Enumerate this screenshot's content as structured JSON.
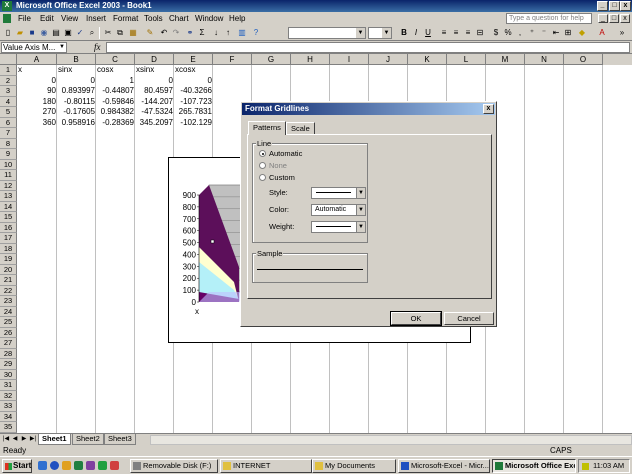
{
  "window": {
    "title": "Microsoft Office Excel 2003 - Book1"
  },
  "menu": {
    "items": [
      "File",
      "Edit",
      "View",
      "Insert",
      "Format",
      "Tools",
      "Chart",
      "Window",
      "Help"
    ],
    "help_placeholder": "Type a question for help"
  },
  "formula_bar": {
    "name_box": "Value Axis M...",
    "fx": "fx",
    "content": ""
  },
  "columns": [
    "A",
    "B",
    "C",
    "D",
    "E",
    "F",
    "G",
    "H",
    "I",
    "J",
    "K",
    "L",
    "M",
    "N",
    "O"
  ],
  "rows": [
    "1",
    "2",
    "3",
    "4",
    "5",
    "6",
    "7",
    "8",
    "9",
    "10",
    "11",
    "12",
    "13",
    "14",
    "15",
    "16",
    "17",
    "18",
    "19",
    "20",
    "21",
    "22",
    "23",
    "24",
    "25",
    "26",
    "27",
    "28",
    "29",
    "30",
    "31",
    "32",
    "33",
    "34",
    "35"
  ],
  "cells": [
    [
      "x",
      "sinx",
      "cosx",
      "xsinx",
      "xcosx"
    ],
    [
      "0",
      "0",
      "1",
      "0",
      "0"
    ],
    [
      "90",
      "0.893997",
      "-0.44807",
      "80.4597",
      "-40.3266"
    ],
    [
      "180",
      "-0.80115",
      "-0.59846",
      "-144.207",
      "-107.723"
    ],
    [
      "270",
      "-0.17605",
      "0.984382",
      "-47.5324",
      "265.7831"
    ],
    [
      "360",
      "0.958916",
      "-0.28369",
      "345.2097",
      "-102.129"
    ]
  ],
  "chart_data": {
    "type": "area",
    "y_ticks": [
      "900",
      "800",
      "700",
      "600",
      "500",
      "400",
      "300",
      "200",
      "100",
      "0"
    ],
    "xlabel": "x",
    "colors": [
      "#5c0f5a",
      "#ffffd0",
      "#b4f0f8",
      "#660066",
      "#c0c0ff"
    ]
  },
  "sheets": {
    "tabs": [
      "Sheet1",
      "Sheet2",
      "Sheet3"
    ],
    "active": "Sheet1"
  },
  "status": {
    "left": "Ready",
    "caps": "CAPS"
  },
  "dialog": {
    "title": "Format Gridlines",
    "close": "x",
    "tabs": [
      "Patterns",
      "Scale"
    ],
    "line_group": "Line",
    "options": [
      "Automatic",
      "None",
      "Custom"
    ],
    "style_label": "Style:",
    "color_label": "Color:",
    "color_value": "Automatic",
    "weight_label": "Weight:",
    "sample_label": "Sample",
    "ok": "OK",
    "cancel": "Cancel"
  },
  "taskbar": {
    "start": "Start",
    "buttons": [
      "Removable Disk (F:)",
      "INTERNET",
      "My Documents",
      "Microsoft-Excel - Micr...",
      "Microsoft Office Exc..."
    ],
    "clock": "11:03 AM"
  }
}
